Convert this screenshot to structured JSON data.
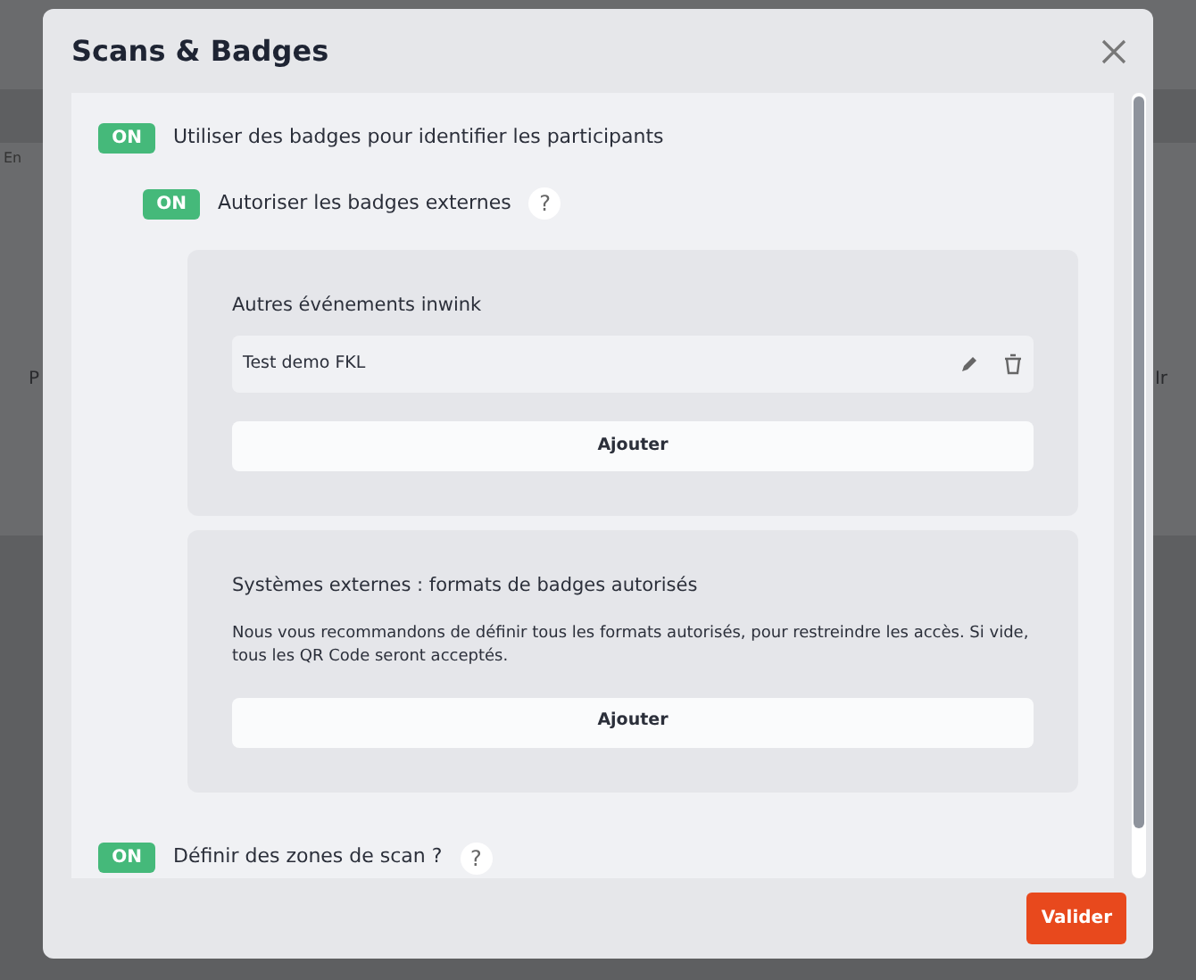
{
  "background": {
    "status": "En",
    "side_left": "P",
    "side_right": "Ir"
  },
  "dialog": {
    "title": "Scans & Badges",
    "toggles": [
      {
        "label": "ON",
        "on": true,
        "text": "Utiliser des badges pour identifier les participants",
        "nested": false
      },
      {
        "label": "ON",
        "on": true,
        "text": "Autoriser les badges externes",
        "help": "?",
        "nested": true
      }
    ],
    "cards": [
      {
        "title": "Autres événements inwink",
        "items": [
          {
            "name": "Test demo FKL"
          }
        ],
        "button": "Ajouter"
      },
      {
        "title": "Systèmes externes : formats de badges autorisés",
        "description": "Nous vous recommandons de définir tous les formats autorisés, pour restreindre les accès. Si vide, tous les QR Code seront acceptés.",
        "button": "Ajouter"
      }
    ],
    "last_toggle": {
      "label": "ON",
      "on": true,
      "text": "Définir des zones de scan ?",
      "help": "?"
    },
    "submit": "Valider"
  }
}
